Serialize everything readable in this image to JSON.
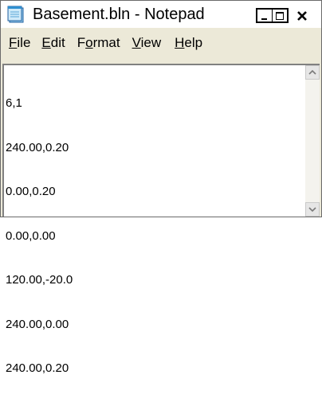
{
  "window": {
    "title": "Basement.bln - Notepad",
    "icon": "notepad-icon"
  },
  "title_buttons": {
    "minimize_icon": "minimize-icon",
    "maximize_icon": "maximize-icon",
    "close_icon": "close-icon"
  },
  "menu": {
    "items": [
      {
        "key": "F",
        "rest": "ile"
      },
      {
        "key": "E",
        "rest": "dit"
      },
      {
        "pre": "F",
        "key": "o",
        "rest": "rmat"
      },
      {
        "key": "V",
        "rest": "iew"
      },
      {
        "key": "H",
        "rest": "elp"
      }
    ]
  },
  "document": {
    "lines": [
      "6,1",
      "240.00,0.20",
      "0.00,0.20",
      "0.00,0.00",
      "120.00,-20.0",
      "240.00,0.00",
      "240.00,0.20"
    ]
  },
  "colors": {
    "window_bg": "#ece9d8",
    "editor_bg": "#ffffff"
  }
}
